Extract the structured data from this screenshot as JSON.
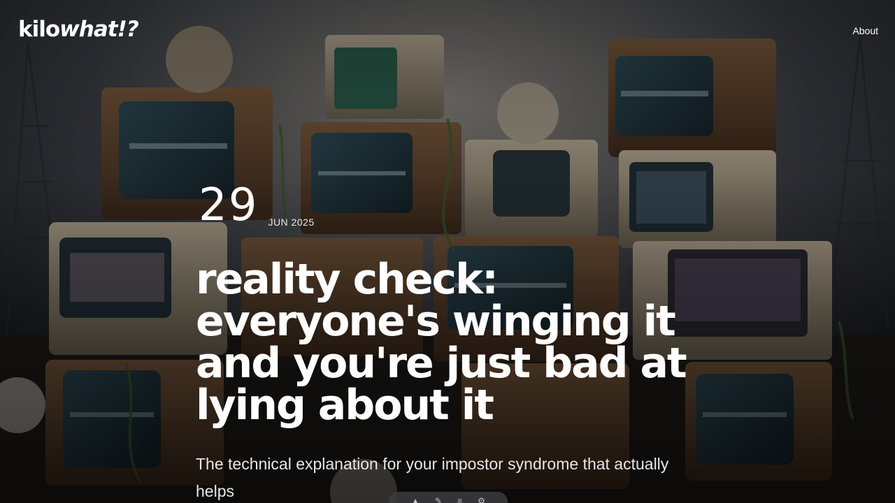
{
  "header": {
    "logo_main": "kilo",
    "logo_italic": "what!?",
    "nav_about": "About"
  },
  "post": {
    "date_day": "29",
    "date_month_year": "JUN 2025",
    "title": "reality check: everyone's winging it and you're just bad at lying about it",
    "subtitle": "The technical explanation for your impostor syndrome that actually helps"
  },
  "hero_image": {
    "description_icon": "stacked-retro-tv-icon"
  },
  "colors": {
    "text": "#ffffff",
    "subtitle": "#e6e6e6",
    "overlay": "#000000"
  }
}
